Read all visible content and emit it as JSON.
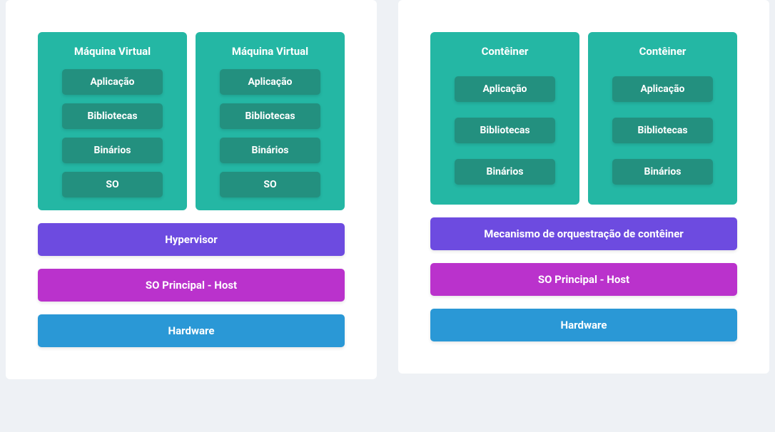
{
  "left": {
    "boxes": [
      {
        "title": "Máquina Virtual",
        "items": [
          "Aplicação",
          "Bibliotecas",
          "Binários",
          "SO"
        ]
      },
      {
        "title": "Máquina Virtual",
        "items": [
          "Aplicação",
          "Bibliotecas",
          "Binários",
          "SO"
        ]
      }
    ],
    "layers": {
      "hypervisor": "Hypervisor",
      "host_os": "SO Principal - Host",
      "hardware": "Hardware"
    }
  },
  "right": {
    "boxes": [
      {
        "title": "Contêiner",
        "items": [
          "Aplicação",
          "Bibliotecas",
          "Binários"
        ]
      },
      {
        "title": "Contêiner",
        "items": [
          "Aplicação",
          "Bibliotecas",
          "Binários"
        ]
      }
    ],
    "layers": {
      "orchestration": "Mecanismo de orquestração de contêiner",
      "host_os": "SO Principal - Host",
      "hardware": "Hardware"
    }
  }
}
